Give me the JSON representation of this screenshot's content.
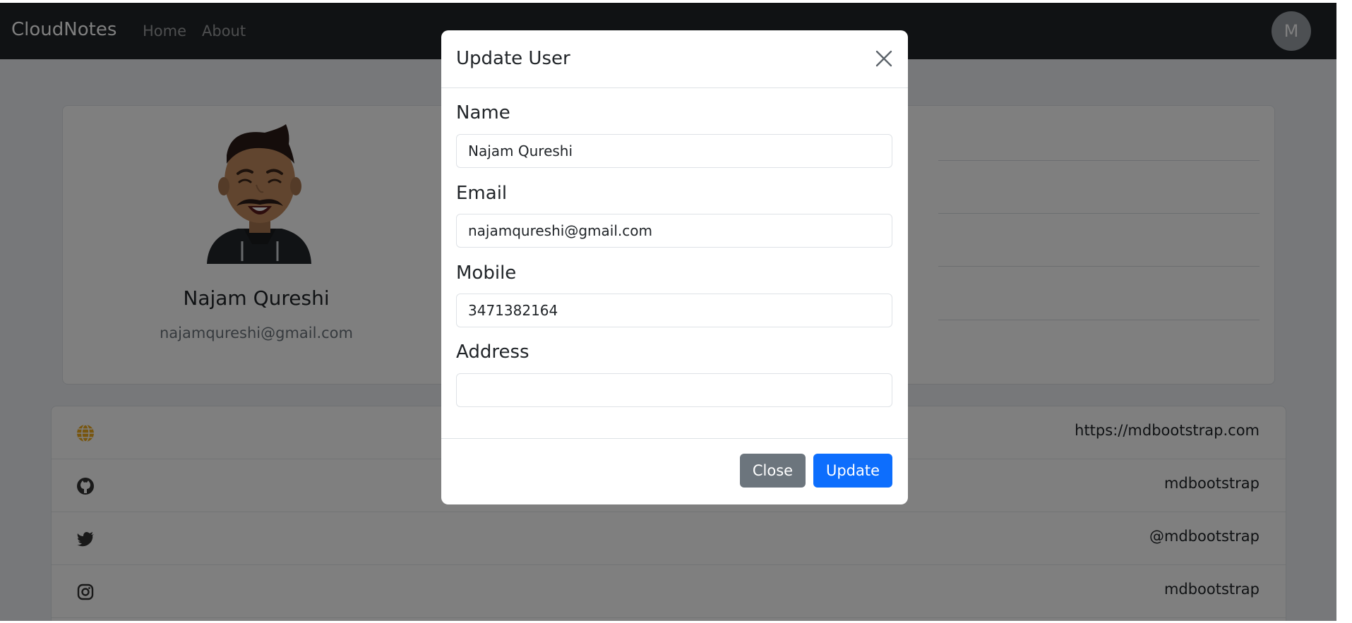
{
  "navbar": {
    "brand": "CloudNotes",
    "links": [
      "Home",
      "About"
    ],
    "avatar_initial": "M"
  },
  "profile": {
    "name": "Najam Qureshi",
    "email": "najamqureshi@gmail.com"
  },
  "links": [
    {
      "icon": "globe-icon",
      "value": "https://mdbootstrap.com"
    },
    {
      "icon": "github-icon",
      "value": "mdbootstrap"
    },
    {
      "icon": "twitter-icon",
      "value": "@mdbootstrap"
    },
    {
      "icon": "instagram-icon",
      "value": "mdbootstrap"
    }
  ],
  "modal": {
    "title": "Update User",
    "fields": {
      "name": {
        "label": "Name",
        "value": "Najam Qureshi"
      },
      "email": {
        "label": "Email",
        "value": "najamqureshi@gmail.com"
      },
      "mobile": {
        "label": "Mobile",
        "value": "3471382164"
      },
      "address": {
        "label": "Address",
        "value": ""
      }
    },
    "close_label": "Close",
    "update_label": "Update"
  },
  "colors": {
    "navbar": "#212529",
    "primary": "#0d6efd",
    "secondary": "#6c757d",
    "globe": "#f0ad1e"
  }
}
